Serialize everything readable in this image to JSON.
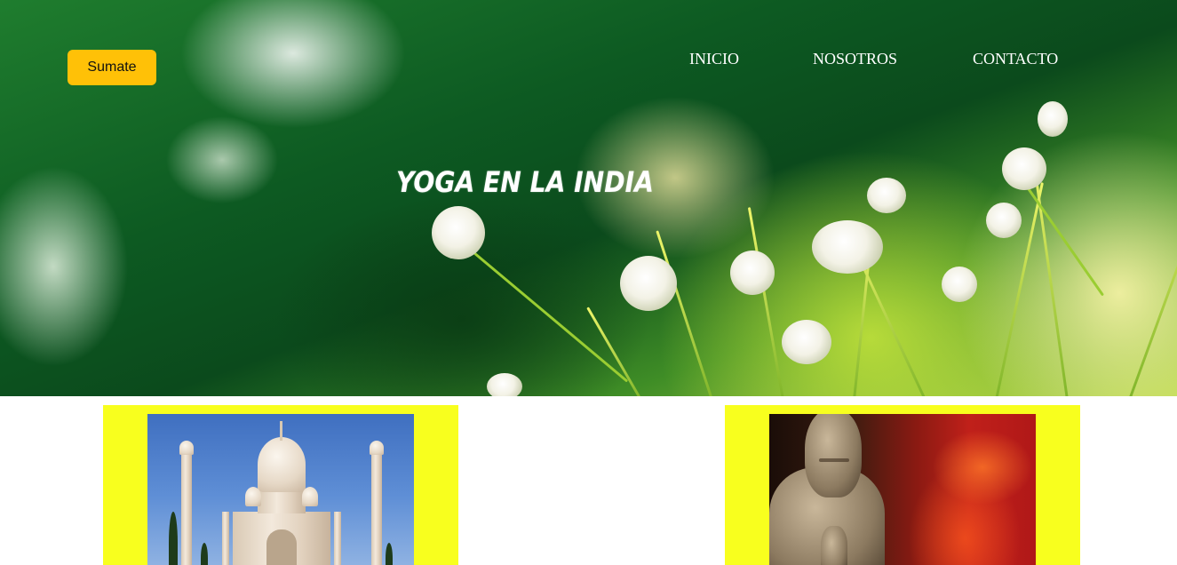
{
  "header": {
    "join_button": "Sumate",
    "nav": [
      {
        "label": "INICIO"
      },
      {
        "label": "NOSOTROS"
      },
      {
        "label": "CONTACTO"
      }
    ]
  },
  "hero": {
    "title": "YOGA EN LA INDIA"
  },
  "gallery": {
    "cards": [
      {
        "image": "taj-mahal-image"
      },
      {
        "image": "buddha-statue-image"
      }
    ]
  },
  "colors": {
    "join_button": "#ffc107",
    "card_background": "#f8ff1e",
    "nav_text": "#ffffff"
  }
}
